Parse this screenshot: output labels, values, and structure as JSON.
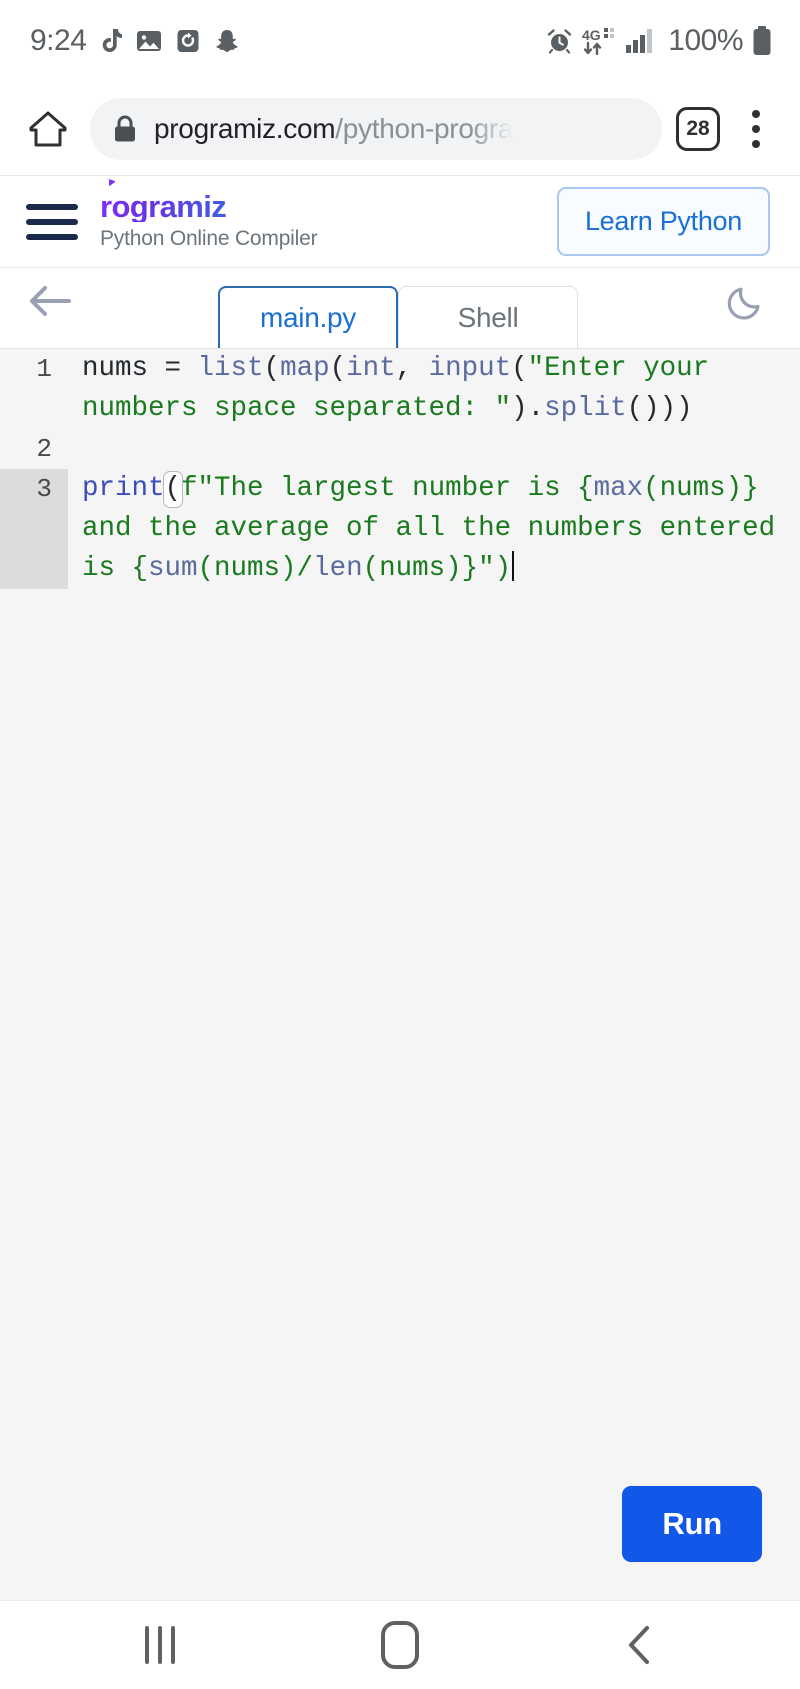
{
  "statusbar": {
    "time": "9:24",
    "battery_percent": "100%",
    "network": "4G",
    "left_icons": [
      "tiktok-note-icon",
      "gallery-image-icon",
      "screen-recorder-icon",
      "snapchat-ghost-icon"
    ],
    "right_icons": [
      "alarm-clock-icon",
      "4g-data-icon",
      "signal-bars-icon",
      "battery-icon"
    ]
  },
  "browser": {
    "home_icon": "home-icon",
    "lock_icon": "lock-icon",
    "url_domain": "programiz.com",
    "url_path": "/python-progra",
    "tab_count": "28",
    "menu_icon": "kebab-menu-icon"
  },
  "site": {
    "menu_icon": "hamburger-menu-icon",
    "brand": "rogramiz",
    "subtitle": "Python Online Compiler",
    "cta_label": "Learn Python",
    "brand_color": "#2f6fe0"
  },
  "editor": {
    "back_icon": "back-arrow-icon",
    "theme_icon": "moon-dark-mode-icon",
    "tabs": [
      {
        "label": "main.py",
        "active": true
      },
      {
        "label": "Shell",
        "active": false
      }
    ],
    "active_tab_color": "#1a6fd4",
    "run_label": "Run",
    "run_color": "#1257e8",
    "lines": [
      {
        "number": "1",
        "highlighted": false
      },
      {
        "number": "2",
        "highlighted": false
      },
      {
        "number": "3",
        "highlighted": true
      }
    ],
    "code": {
      "line1_var": "nums",
      "line1_eq": " = ",
      "line1_list": "list",
      "line1_map": "map",
      "line1_int": "int",
      "line1_input": "input",
      "line1_string": "\"Enter your numbers space separated: \"",
      "line1_split": "split",
      "line3_print": "print",
      "line3_fstring_a": "f\"The largest number is {",
      "line3_max": "max",
      "line3_mid": "(nums)} and the average of all the numbers entered is {",
      "line3_sum": "sum",
      "line3_div": "(nums)/",
      "line3_len": "len",
      "line3_tail": "(nums)}\")"
    },
    "full_code": "nums = list(map(int, input(\"Enter your numbers space separated: \").split()))\n\nprint(f\"The largest number is {max(nums)} and the average of all the numbers entered is {sum(nums)/len(nums)}\")"
  },
  "navbar": {
    "recents_icon": "recents-icon",
    "home_icon": "home-pill-icon",
    "back_icon": "back-chevron-icon"
  }
}
